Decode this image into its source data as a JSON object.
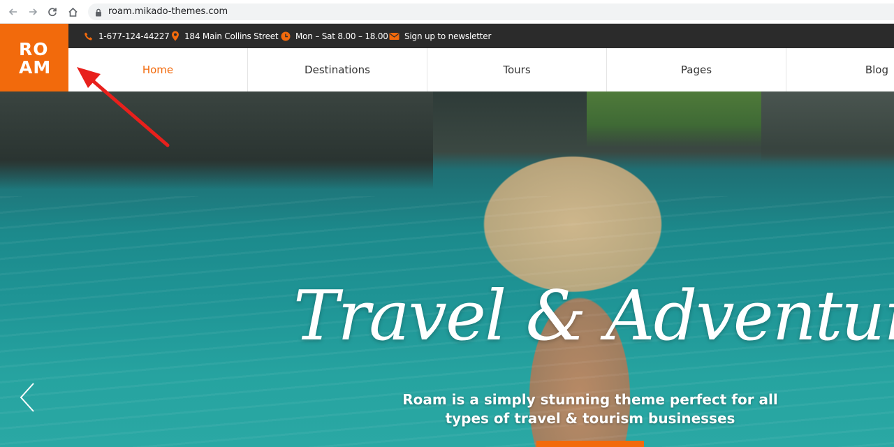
{
  "browser": {
    "url": "roam.mikado-themes.com",
    "back_icon": "arrow-left-icon",
    "forward_icon": "arrow-right-icon",
    "reload_icon": "reload-icon",
    "home_icon": "home-icon",
    "lock_icon": "lock-icon"
  },
  "logo": {
    "line1": "RO",
    "line2": "AM",
    "color": "#f26a0c"
  },
  "topbar": {
    "phone": "1-677-124-44227",
    "address": "184 Main Collins Street",
    "hours": "Mon – Sat 8.00 – 18.00",
    "newsletter": "Sign up to newsletter",
    "icon_color": "#f26a0c"
  },
  "nav": {
    "items": [
      {
        "label": "Home",
        "active": true
      },
      {
        "label": "Destinations",
        "active": false
      },
      {
        "label": "Tours",
        "active": false
      },
      {
        "label": "Pages",
        "active": false
      },
      {
        "label": "Blog",
        "active": false
      }
    ]
  },
  "hero": {
    "title": "Travel & Adventure",
    "subtitle_line1": "Roam is a simply stunning theme perfect for all",
    "subtitle_line2": "types of travel & tourism businesses",
    "prev_icon": "chevron-left-icon"
  },
  "annotation": {
    "color": "#e8201c"
  }
}
